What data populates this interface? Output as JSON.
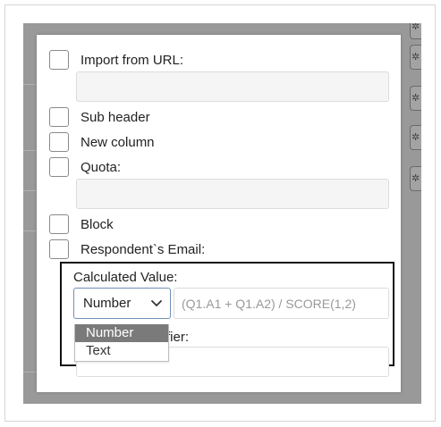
{
  "form": {
    "items": [
      {
        "label": "Import from URL:"
      },
      {
        "label": "Sub header"
      },
      {
        "label": "New column"
      },
      {
        "label": "Quota:"
      },
      {
        "label": "Block"
      },
      {
        "label": "Respondent`s Email:"
      }
    ],
    "calculated_value": {
      "label": "Calculated Value:",
      "type_select": {
        "value": "Number"
      },
      "formula_placeholder": "(Q1.A1 + Q1.A2) / SCORE(1,2)",
      "dropdown_options": [
        "Number",
        "Text"
      ]
    },
    "obscured_field": {
      "label_fragment": "fier:"
    }
  },
  "colors": {
    "backdrop": "#999999",
    "highlight_border": "#111111",
    "selected_option_bg": "#7a7a7a",
    "select_border": "#6f8fb8"
  },
  "icons": {
    "side_icons": "settings-icon",
    "select_chevron": "chevron-down-icon"
  }
}
